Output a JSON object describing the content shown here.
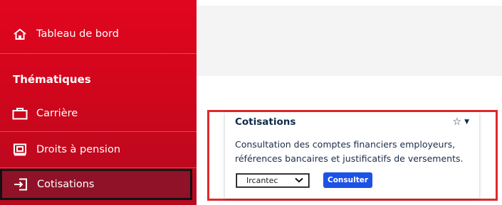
{
  "sidebar": {
    "dashboard_label": "Tableau de bord",
    "section_heading": "Thématiques",
    "items": [
      {
        "label": "Carrière",
        "icon": "briefcase-icon"
      },
      {
        "label": "Droits à pension",
        "icon": "pension-icon"
      },
      {
        "label": "Cotisations",
        "icon": "enter-icon",
        "active": true
      }
    ],
    "colors": {
      "background": "#d0061c",
      "active_background": "#8f1228"
    }
  },
  "card": {
    "title": "Cotisations",
    "star_icon": "star-icon",
    "description": "Consultation des comptes financiers employeurs, références bancaires et justificatifs de versements.",
    "select_value": "Ircantec",
    "button_label": "Consulter",
    "colors": {
      "highlight_border": "#e0292b",
      "button": "#1c52e5",
      "title": "#102a4a"
    }
  }
}
